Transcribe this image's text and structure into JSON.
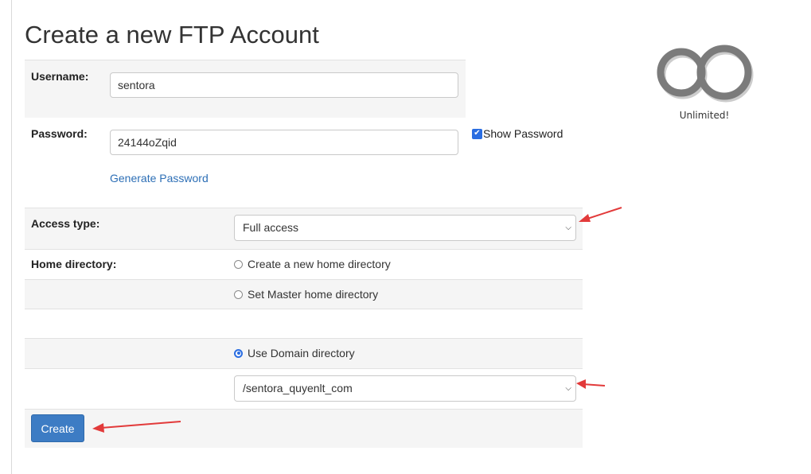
{
  "page": {
    "title": "Create a new FTP Account"
  },
  "form": {
    "username": {
      "label": "Username:",
      "value": "sentora"
    },
    "password": {
      "label": "Password:",
      "value": "24144oZqid",
      "show_password_label": "Show Password",
      "show_password_checked": true,
      "generate_label": "Generate Password"
    },
    "access_type": {
      "label": "Access type:",
      "selected": "Full access"
    },
    "home_directory": {
      "label": "Home directory:",
      "options": [
        {
          "label": "Create a new home directory",
          "selected": false
        },
        {
          "label": "Set Master home directory",
          "selected": false
        },
        {
          "label": "Use Domain directory",
          "selected": true
        }
      ]
    },
    "domain_directory": {
      "selected": "/sentora_quyenlt_com"
    },
    "submit_label": "Create"
  },
  "quota": {
    "caption": "Unlimited!",
    "icon": "infinity-icon"
  },
  "colors": {
    "accent": "#3d7cc4",
    "link": "#2d6fb6",
    "annotation_arrow": "#e23a3a"
  },
  "icons": {
    "chevron": "chevron-down-icon",
    "annotation": "red-arrow-icon"
  }
}
